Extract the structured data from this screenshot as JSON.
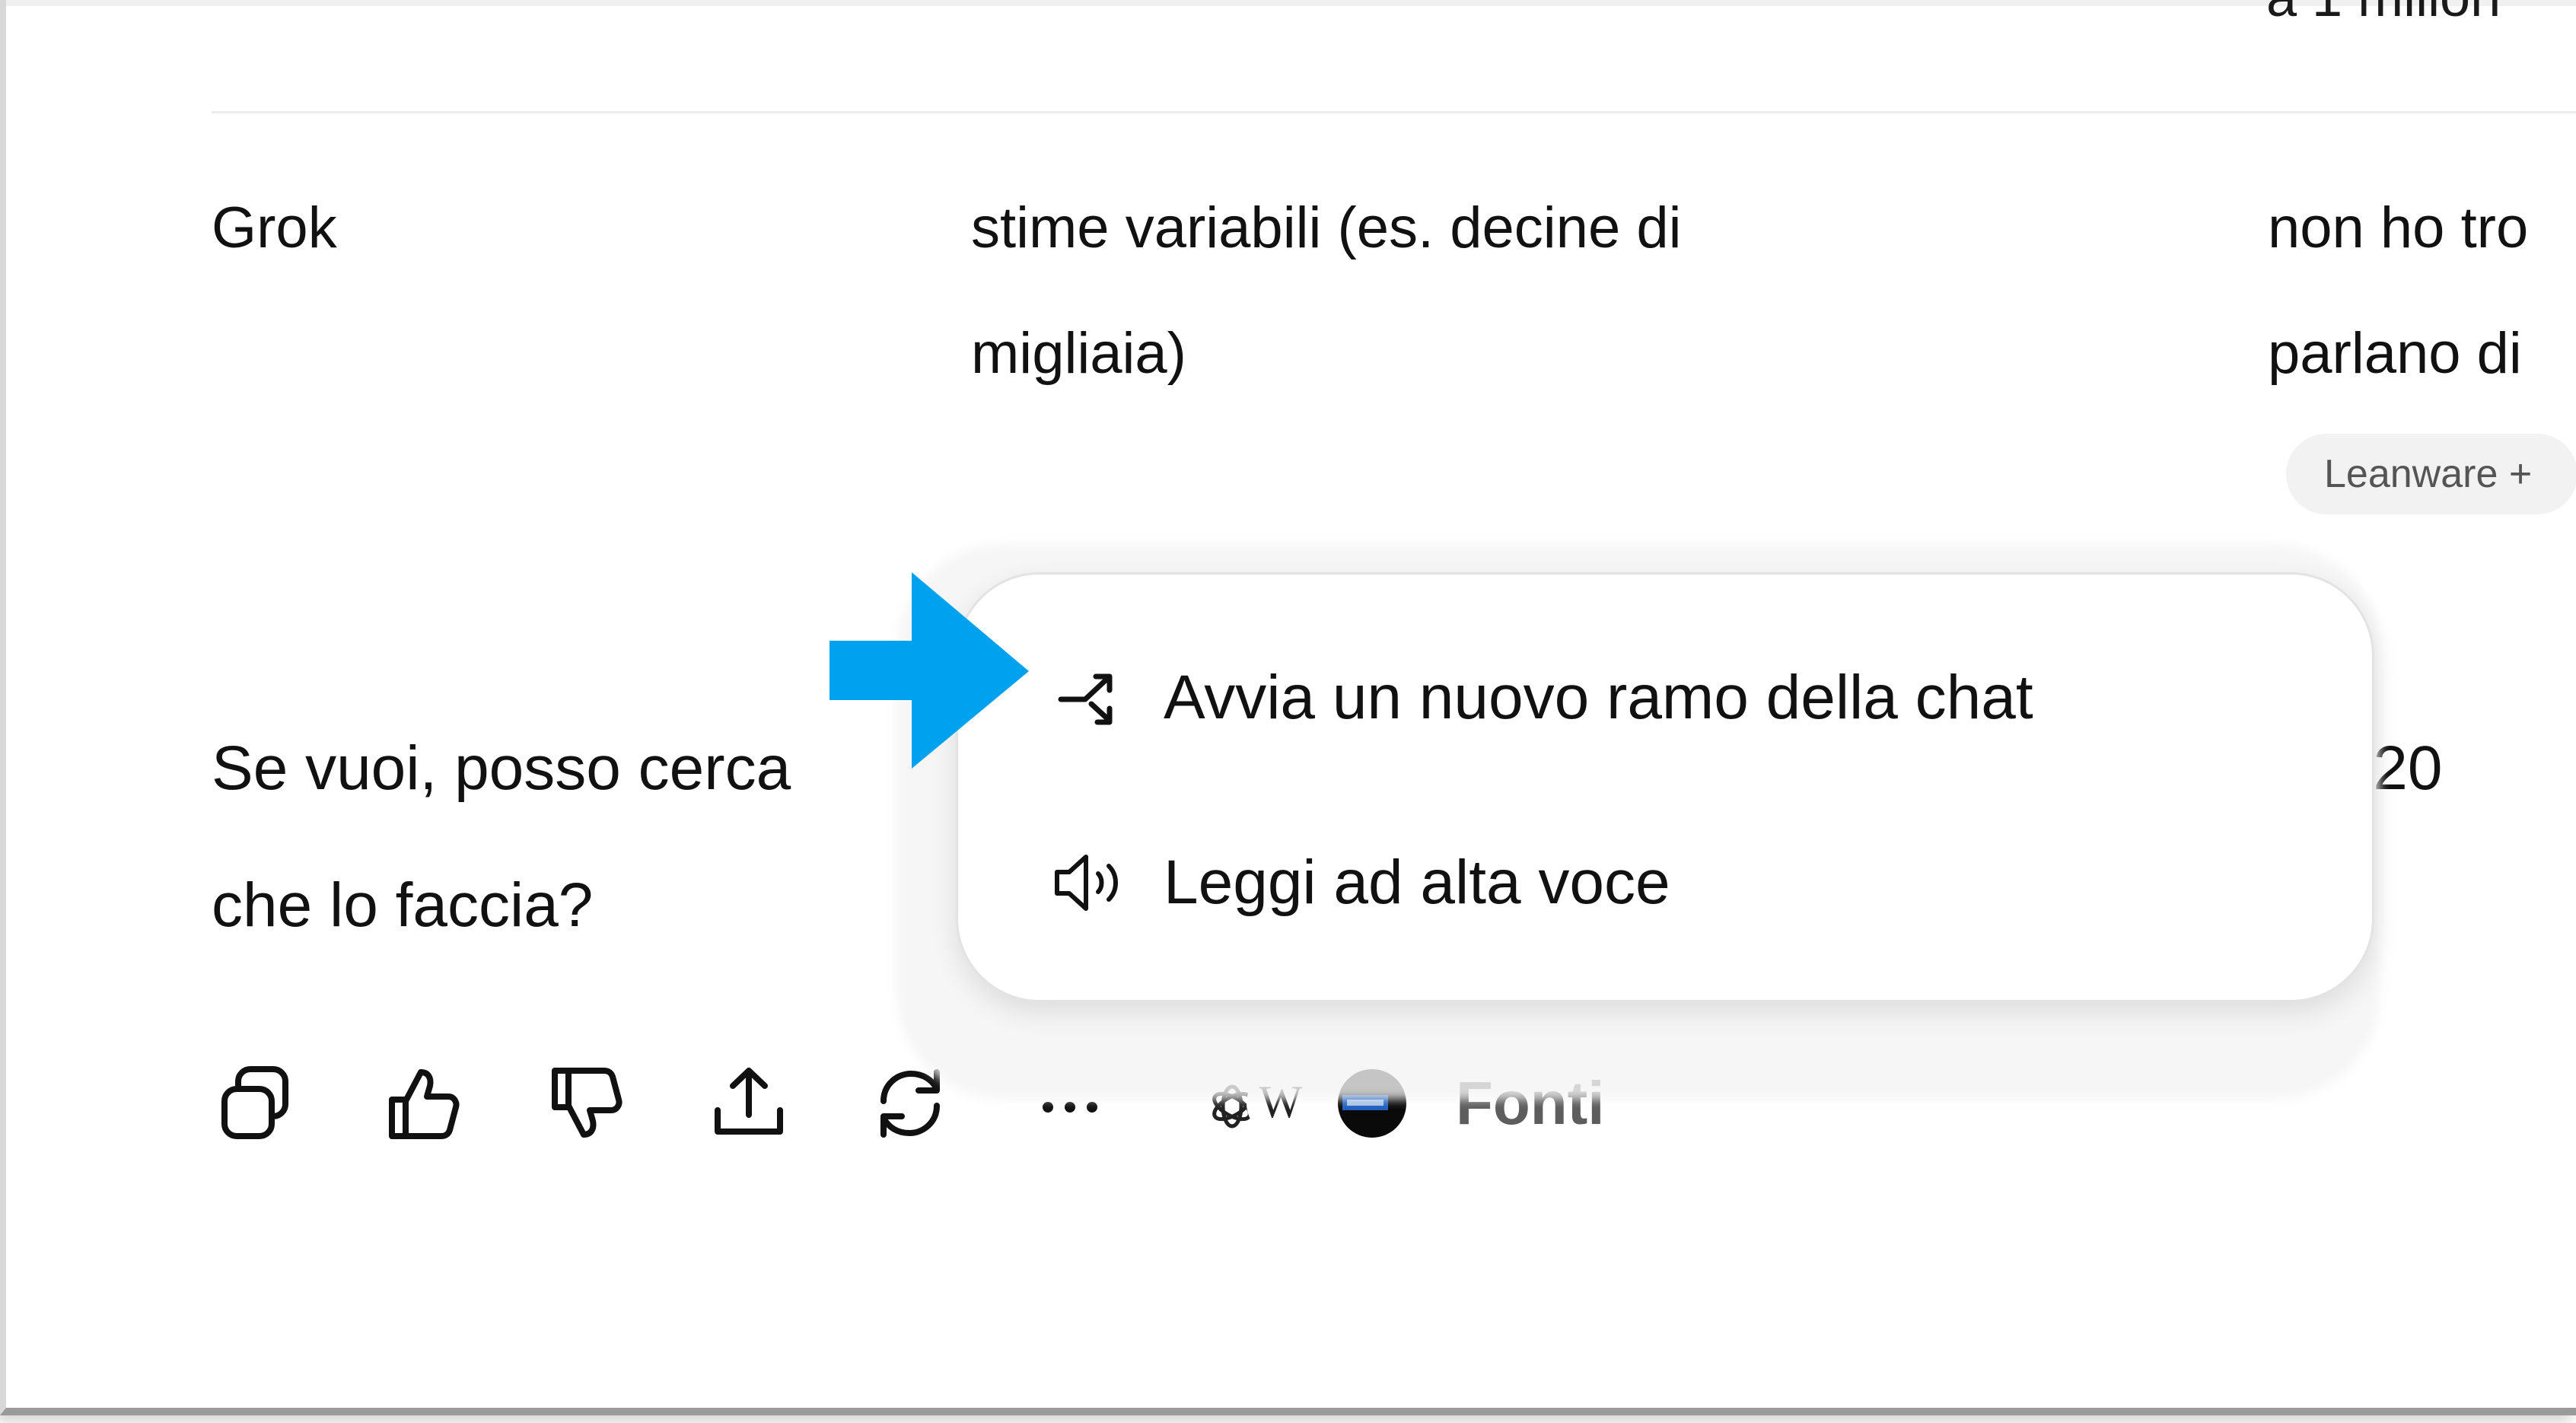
{
  "top_cut_text": "a 1 milion",
  "table_row": {
    "model": "Grok",
    "estimate_line1": "stime variabili (es. decine di",
    "estimate_line2": "migliaia)",
    "note_line1": "non ho tro",
    "note_line2": "parlano di",
    "source_pill": "Leanware +"
  },
  "paragraph": {
    "line1_start": "Se vuoi, posso cerca",
    "line1_end": "del 20",
    "line2": "che lo faccia?"
  },
  "toolbar": {
    "sources_label": "Fonti"
  },
  "context_menu": {
    "items": [
      {
        "label": "Avvia un nuovo ramo della chat",
        "icon": "branch-icon"
      },
      {
        "label": "Leggi ad alta voce",
        "icon": "speaker-icon"
      }
    ]
  },
  "colors": {
    "arrow": "#00A2F0",
    "text": "#0D0D0D",
    "muted": "#5D5D5D",
    "pill_bg": "#F2F2F2"
  }
}
